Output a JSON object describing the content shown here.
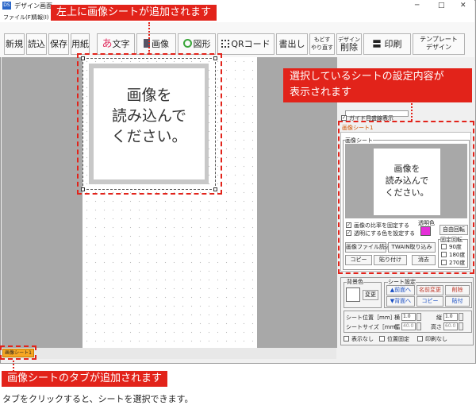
{
  "window": {
    "title": "デザイン画面",
    "min": "─",
    "max": "□",
    "close": "✕"
  },
  "menu": [
    "ファイル(F)",
    "情報(I)"
  ],
  "toolbar": {
    "new": "新規",
    "load": "読込",
    "save": "保存",
    "paper": "用紙",
    "text_glyph": "あ",
    "text": "文字",
    "image": "画像",
    "shape": "図形",
    "qr": "QRコード",
    "export": "書出し",
    "undo_top": "もどす",
    "undo_bottom": "やり直す",
    "delete_top": "デザイン",
    "delete": "削除",
    "print": "印刷",
    "template_1": "テンプレート",
    "template_2": "デザイン"
  },
  "canvas": {
    "placeholder_1": "画像を",
    "placeholder_2": "読み込んで",
    "placeholder_3": "ください。"
  },
  "panel": {
    "guide_label": "ガイド目盛線表示",
    "section_tab": "画像シート1",
    "group": "画像シート",
    "preview_1": "画像を",
    "preview_2": "読み込んで",
    "preview_3": "ください。",
    "fix_ratio": "画像の比率を固定する",
    "transparent": "透明にする色を設定する",
    "trans_color_label": "透明色",
    "trans_color": "#e52fd8",
    "free_rotate": "自由回転",
    "load_file": "画像ファイル読込",
    "twain": "TWAIN取り込み",
    "copy": "コピー",
    "paste": "貼り付け",
    "erase": "消去",
    "fixed_rotate": "固定回転",
    "rot_90": "90度",
    "rot_180": "180度",
    "rot_270": "270度",
    "bg_label": "背景色",
    "bg_change": "変更",
    "sheet_settings": "シート設定",
    "front": "▲前面へ",
    "rename": "名前変更",
    "del": "削除",
    "back": "▼背面へ",
    "copy2": "コピー",
    "paste2": "貼付",
    "pos_label": "シート位置［mm］",
    "x_label": "横",
    "x_val": "1.0",
    "y_label": "縦",
    "y_val": "1.0",
    "size_label": "シートサイズ［mm］",
    "w_label": "幅",
    "w_val": "40.0",
    "h_label": "高さ",
    "h_val": "60.0",
    "hide": "表示なし",
    "lock_pos": "位置固定",
    "no_print": "印刷なし"
  },
  "sheet_tab": "画像シート1",
  "callouts": {
    "top": "左上に画像シートが追加されます",
    "right_1": "選択しているシートの設定内容が",
    "right_2": "表示されます",
    "bottom": "画像シートのタブが追加されます",
    "bottom_note": "タブをクリックすると、シートを選択できます。"
  }
}
